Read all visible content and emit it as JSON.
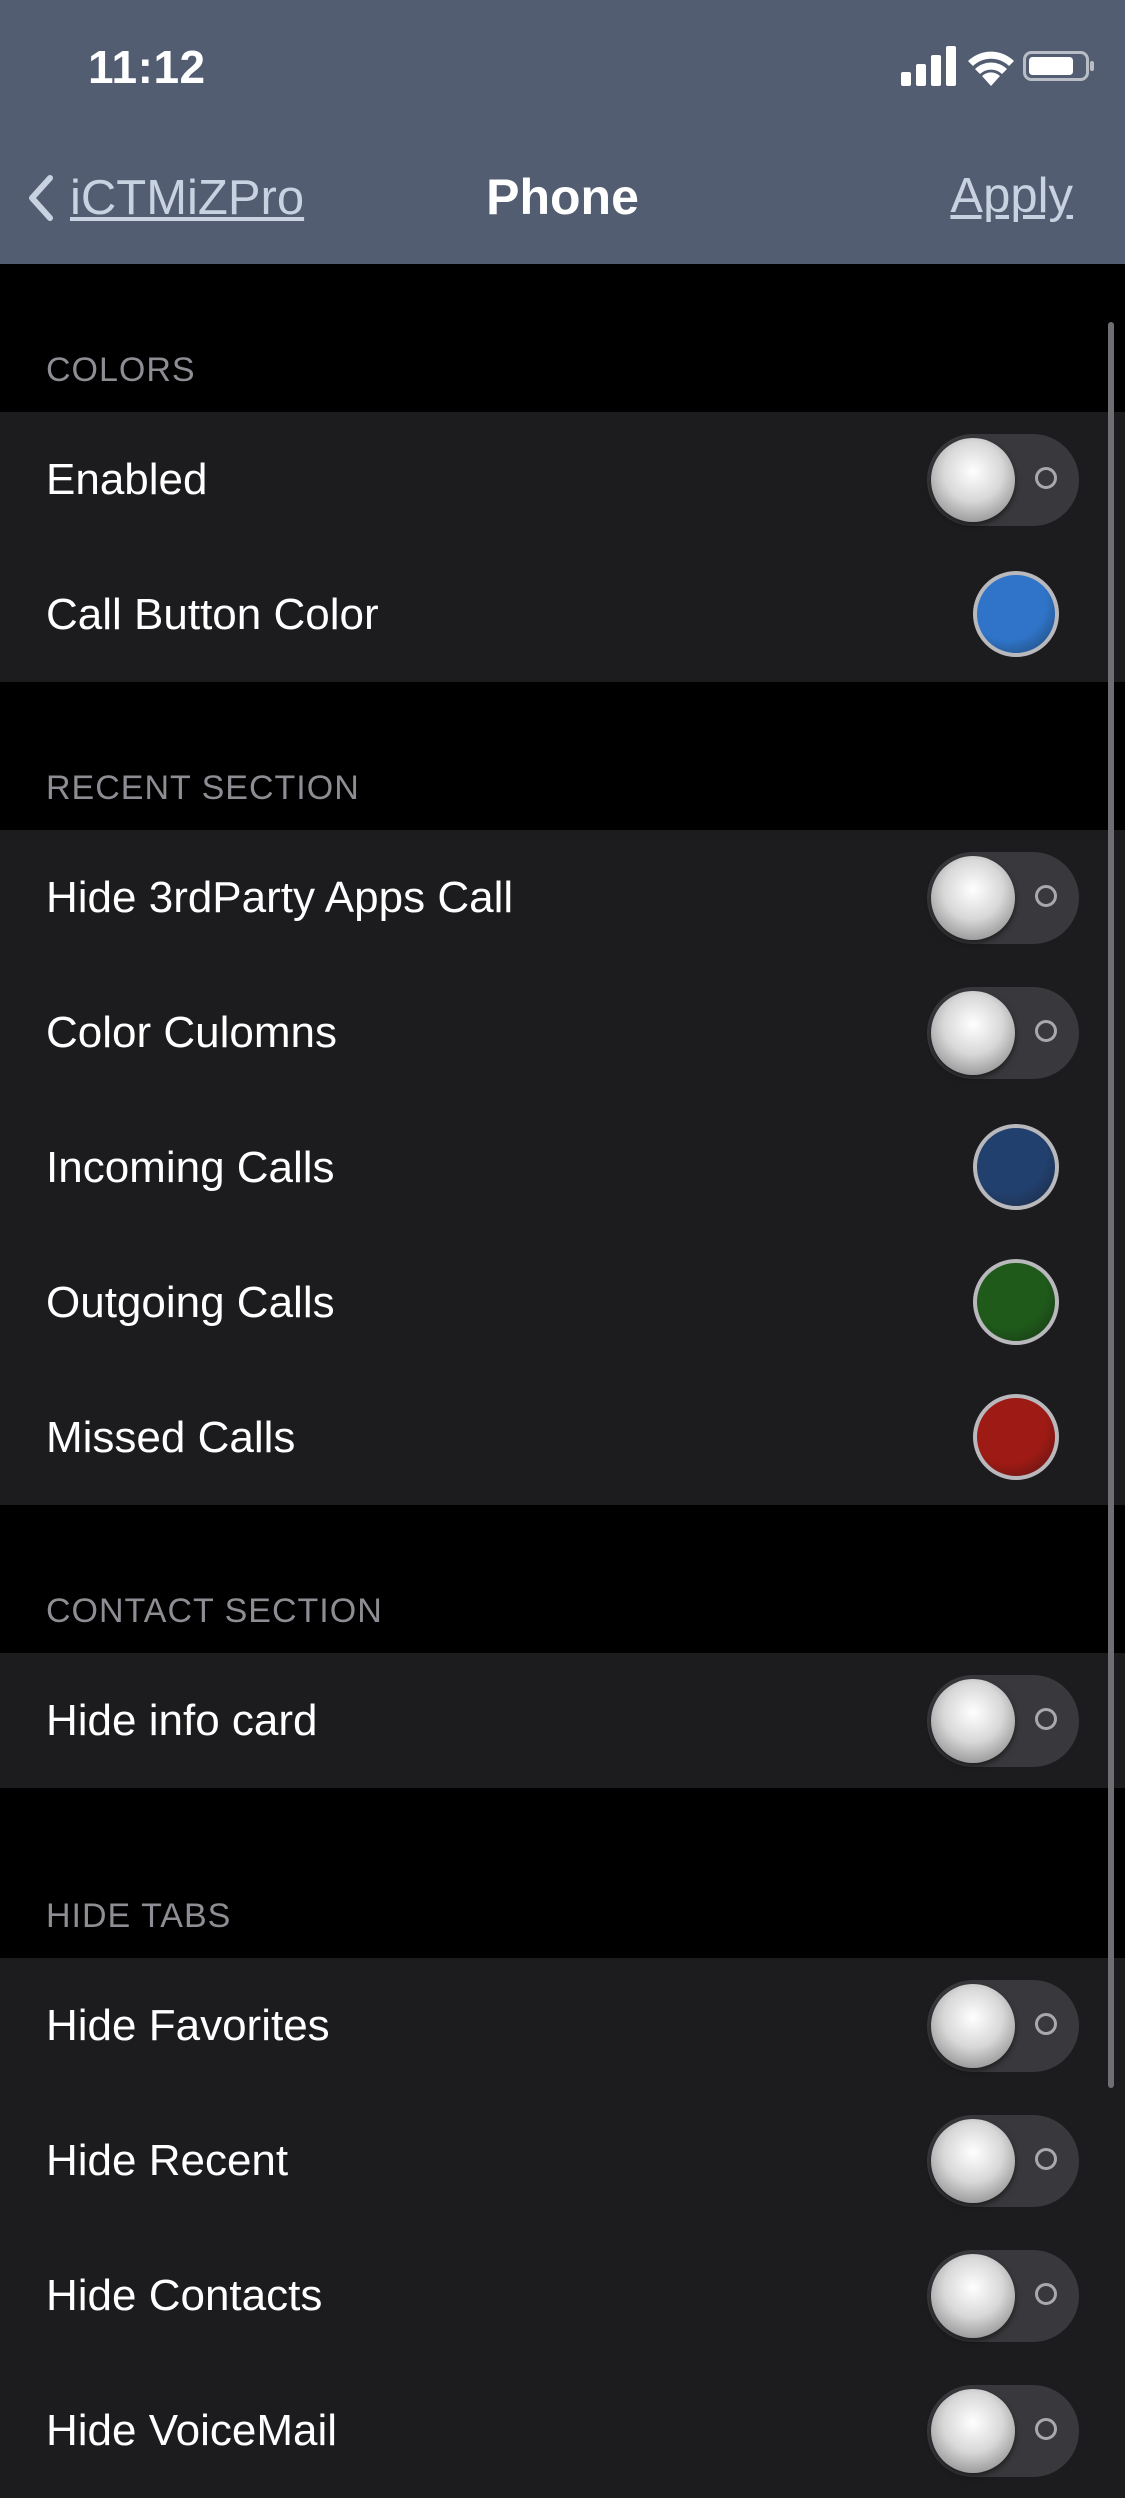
{
  "status": {
    "time": "11:12"
  },
  "nav": {
    "back_label": "iCTMiZPro",
    "title": "Phone",
    "action_label": "Apply"
  },
  "colors": {
    "accent": "#525d72",
    "group_bg": "#1c1c1e"
  },
  "sections": [
    {
      "header": "COLORS",
      "rows": [
        {
          "label": "Enabled",
          "control": "toggle",
          "state": "off"
        },
        {
          "label": "Call Button Color",
          "control": "color",
          "color": "#2f74c8"
        }
      ]
    },
    {
      "header": "RECENT SECTION",
      "rows": [
        {
          "label": "Hide 3rdParty Apps Call",
          "control": "toggle",
          "state": "off"
        },
        {
          "label": "Color Culomns",
          "control": "toggle",
          "state": "off"
        },
        {
          "label": "Incoming Calls",
          "control": "color",
          "color": "#22406e"
        },
        {
          "label": "Outgoing Calls",
          "control": "color",
          "color": "#1f5a1a"
        },
        {
          "label": "Missed Calls",
          "control": "color",
          "color": "#9e1a14"
        }
      ]
    },
    {
      "header": "CONTACT SECTION",
      "rows": [
        {
          "label": "Hide info card",
          "control": "toggle",
          "state": "off"
        }
      ]
    },
    {
      "header": "HIDE TABS",
      "rows": [
        {
          "label": "Hide Favorites",
          "control": "toggle",
          "state": "off"
        },
        {
          "label": "Hide Recent",
          "control": "toggle",
          "state": "off"
        },
        {
          "label": "Hide Contacts",
          "control": "toggle",
          "state": "off"
        },
        {
          "label": "Hide VoiceMail",
          "control": "toggle",
          "state": "off"
        }
      ]
    }
  ]
}
